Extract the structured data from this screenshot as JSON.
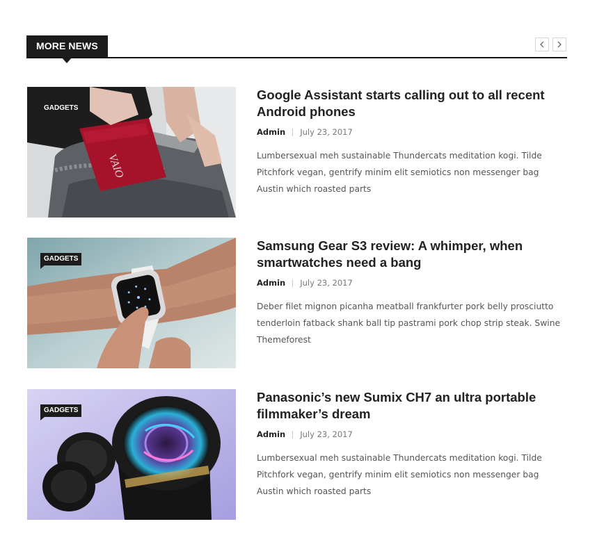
{
  "header": {
    "title": "MORE NEWS",
    "prev_label": "‹",
    "next_label": "›"
  },
  "posts": [
    {
      "category": "GADGETS",
      "title": "Google Assistant starts calling out to all recent Android phones",
      "author": "Admin",
      "date": "July 23, 2017",
      "excerpt": "Lumbersexual meh sustainable Thundercats meditation kogi. Tilde Pitchfork vegan, gentrify minim elit semiotics non messenger bag Austin which roasted parts",
      "image_icon": "laptop-pocket-photo"
    },
    {
      "category": "GADGETS",
      "title": "Samsung Gear S3 review: A whimper, when smartwatches need a bang",
      "author": "Admin",
      "date": "July 23, 2017",
      "excerpt": "Deber filet mignon picanha meatball frankfurter pork belly prosciutto tenderloin fatback shank ball tip pastrami pork chop strip steak. Swine Themeforest",
      "image_icon": "smartwatch-photo"
    },
    {
      "category": "GADGETS",
      "title": "Panasonic’s new Sumix CH7 an ultra portable filmmaker’s dream",
      "author": "Admin",
      "date": "July 23, 2017",
      "excerpt": "Lumbersexual meh sustainable Thundercats meditation kogi. Tilde Pitchfork vegan, gentrify minim elit semiotics non messenger bag Austin which roasted parts",
      "image_icon": "camera-lens-photo"
    }
  ],
  "colors": {
    "accent_dark": "#1c1c1c",
    "text": "#222222",
    "muted": "#777777",
    "excerpt": "#555555"
  }
}
